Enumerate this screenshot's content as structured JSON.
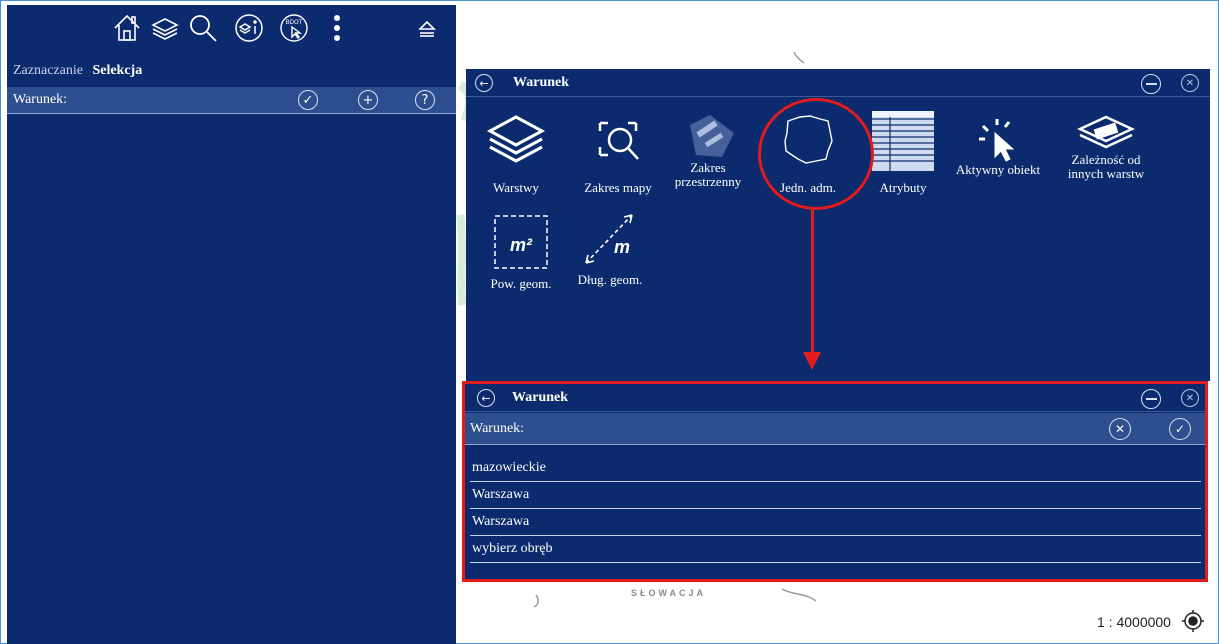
{
  "toolbar": {
    "icons": [
      "home-icon",
      "layers-icon",
      "search-icon",
      "info-layers-icon",
      "bdot-select-icon",
      "more-vertical-icon",
      "eject-icon"
    ],
    "bdot_label": "BDOT"
  },
  "left_panel": {
    "tabs": [
      "Zaznaczanie",
      "Selekcja"
    ],
    "active_tab": "Selekcja",
    "warunek_label": "Warunek:",
    "help_label": "?"
  },
  "dialog_main": {
    "title": "Warunek",
    "tools": [
      {
        "label": "Warstwy",
        "icon": "layers-icon"
      },
      {
        "label": "Zakres mapy",
        "icon": "zoom-extent-icon"
      },
      {
        "label": "Zakres przestrzenny",
        "icon": "spatial-extent-icon"
      },
      {
        "label": "Jedn. adm.",
        "icon": "poland-map-icon"
      },
      {
        "label": "Atrybuty",
        "icon": "attribute-table-icon"
      },
      {
        "label": "Aktywny obiekt",
        "icon": "active-object-icon"
      },
      {
        "label": "Zależność od innych warstw",
        "icon": "layer-dependency-icon"
      },
      {
        "label": "Pow. geom.",
        "icon": "area-icon"
      },
      {
        "label": "Dług. geom.",
        "icon": "length-icon"
      }
    ],
    "area_symbol": "m²",
    "length_symbol": "m"
  },
  "dialog_condition": {
    "title": "Warunek",
    "warunek_label": "Warunek:",
    "rows": [
      "mazowieckie",
      "Warszawa",
      "Warszawa",
      "wybierz obręb"
    ]
  },
  "map": {
    "country_label": "SŁOWACJA",
    "scale": "1 : 4000000"
  },
  "colors": {
    "panel_bg": "#0b2b6e",
    "bar_bg": "#2d4f8f",
    "highlight": "#e21c1c"
  }
}
